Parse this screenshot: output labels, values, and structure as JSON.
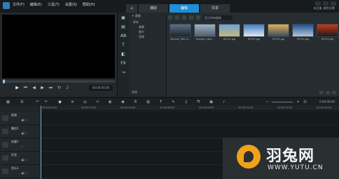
{
  "menu": [
    "文件(F)",
    "编辑(E)",
    "工具(T)",
    "设置(S)",
    "帮助(H)"
  ],
  "tabs": [
    {
      "label": "",
      "icon": "home-icon"
    },
    {
      "label": "捕获"
    },
    {
      "label": "编辑",
      "active": true
    },
    {
      "label": "共享"
    }
  ],
  "status": "未注册, 剩余天数",
  "preview": {
    "timecode": "00:00:00:00"
  },
  "library": {
    "add_label": "添加",
    "filter_label": "显示所有媒体",
    "folders": [
      {
        "label": "样本"
      },
      {
        "label": "故事",
        "sub": true
      },
      {
        "label": "照片",
        "sub": true
      },
      {
        "label": "音频",
        "sub": true
      }
    ],
    "footer_label": "浏览",
    "thumbnails": [
      {
        "caption": "Sample_360.m...",
        "color_top": "#5d7083",
        "color_bottom": "#1b2530"
      },
      {
        "caption": "Sample_Lake...",
        "color_top": "#9db1c2",
        "color_bottom": "#4d5e6c"
      },
      {
        "caption": "SP-I01.jpg",
        "color_top": "#6aa3d8",
        "color_bottom": "#c7b77a"
      },
      {
        "caption": "SP-I02.jpg",
        "color_top": "#3c7fc4",
        "color_bottom": "#e2e7ee"
      },
      {
        "caption": "SP-I03.jpg",
        "color_top": "#e0b057",
        "color_bottom": "#3a4c62"
      },
      {
        "caption": "SP-I04.jpg",
        "color_top": "#1e4f8f",
        "color_bottom": "#b5c6d6"
      },
      {
        "caption": "SP-I05.jpg",
        "color_top": "#c73a1a",
        "color_bottom": "#1b1b1b"
      }
    ]
  },
  "timeline": {
    "time_display": "0:00:00:00",
    "ruler_ticks": [
      "00:00:00:00",
      "00:00:02:00",
      "00:00:04:00",
      "00:00:06:00",
      "00:00:08:00",
      "00:00:10:00",
      "00:00:12:00",
      "00:00:14:00"
    ],
    "tracks": [
      {
        "name": "视频"
      },
      {
        "name": "叠加1"
      },
      {
        "name": "标题1"
      },
      {
        "name": "声音"
      },
      {
        "name": "音乐1"
      }
    ]
  },
  "watermark": {
    "title": "羽兔网",
    "url": "WWW.YUTU.CN"
  }
}
